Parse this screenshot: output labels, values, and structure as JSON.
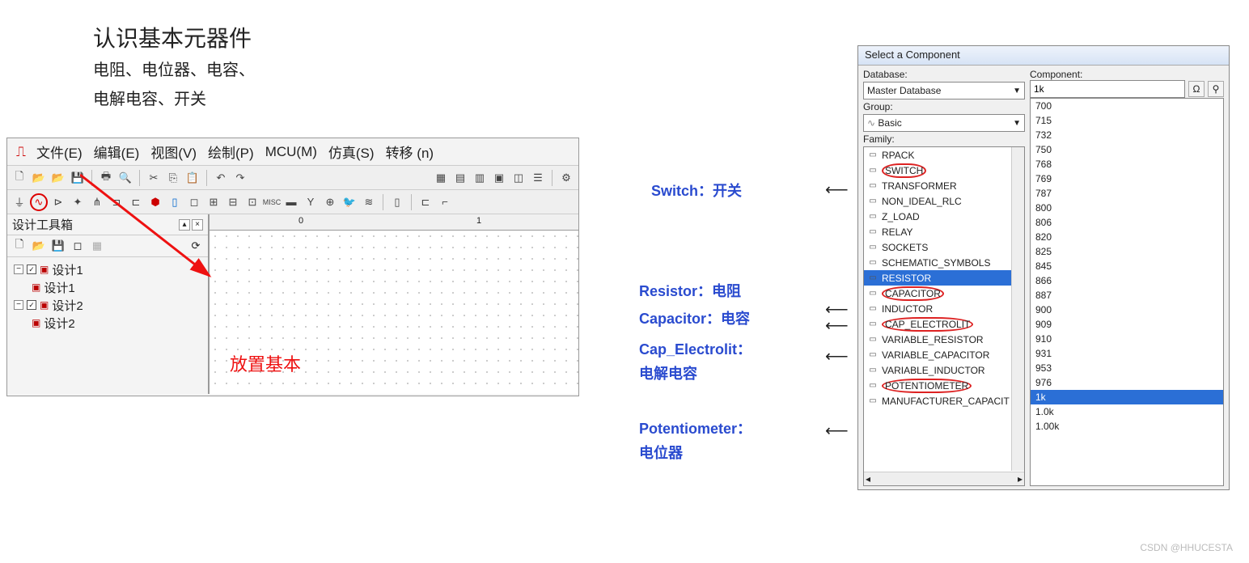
{
  "heading": {
    "main": "认识基本元器件",
    "sub1": "电阻、电位器、电容、",
    "sub2": "电解电容、开关"
  },
  "menu": [
    "文件(E)",
    "编辑(E)",
    "视图(V)",
    "绘制(P)",
    "MCU(M)",
    "仿真(S)",
    "转移 (n)"
  ],
  "design_panel": {
    "title": "设计工具箱"
  },
  "tree": {
    "n1": "设计1",
    "n1a": "设计1",
    "n2": "设计2",
    "n2a": "设计2"
  },
  "ruler": {
    "m0": "0",
    "m1": "1"
  },
  "annotation": "放置基本",
  "dialog": {
    "title": "Select a Component",
    "database_lbl": "Database:",
    "database_val": "Master Database",
    "group_lbl": "Group:",
    "group_val": "Basic",
    "family_lbl": "Family:",
    "component_lbl": "Component:",
    "component_val": "1k"
  },
  "families": [
    {
      "label": "RPACK",
      "circled": false
    },
    {
      "label": "SWITCH",
      "circled": true
    },
    {
      "label": "TRANSFORMER",
      "circled": false
    },
    {
      "label": "NON_IDEAL_RLC",
      "circled": false
    },
    {
      "label": "Z_LOAD",
      "circled": false
    },
    {
      "label": "RELAY",
      "circled": false
    },
    {
      "label": "SOCKETS",
      "circled": false
    },
    {
      "label": "SCHEMATIC_SYMBOLS",
      "circled": false
    },
    {
      "label": "RESISTOR",
      "circled": true,
      "selected": true
    },
    {
      "label": "CAPACITOR",
      "circled": true
    },
    {
      "label": "INDUCTOR",
      "circled": false
    },
    {
      "label": "CAP_ELECTROLIT",
      "circled": true
    },
    {
      "label": "VARIABLE_RESISTOR",
      "circled": false
    },
    {
      "label": "VARIABLE_CAPACITOR",
      "circled": false
    },
    {
      "label": "VARIABLE_INDUCTOR",
      "circled": false
    },
    {
      "label": "POTENTIOMETER",
      "circled": true
    },
    {
      "label": "MANUFACTURER_CAPACIT",
      "circled": false
    }
  ],
  "components": [
    "700",
    "715",
    "732",
    "750",
    "768",
    "769",
    "787",
    "800",
    "806",
    "820",
    "825",
    "845",
    "866",
    "887",
    "900",
    "909",
    "910",
    "931",
    "953",
    "976",
    "1k",
    "1.0k",
    "1.00k"
  ],
  "component_selected": "1k",
  "legends": {
    "switch": "Switch：开关",
    "resistor": "Resistor：电阻",
    "capacitor": "Capacitor：电容",
    "capel1": "Cap_Electrolit：",
    "capel2": "电解电容",
    "pot1": "Potentiometer：",
    "pot2": "电位器"
  },
  "footer": "CSDN @HHUCESTA"
}
